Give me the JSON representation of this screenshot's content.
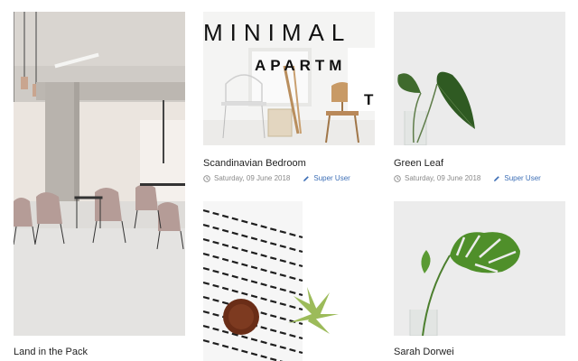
{
  "cards": [
    {
      "title": "Land in the Pack",
      "image_icon": "office-interior-photo"
    },
    {
      "title": "Scandinavian Bedroom",
      "date": "Saturday, 09 June 2018",
      "author": "Super User",
      "image_icon": "scandinavian-room-photo",
      "overlay_line1": "MINIMAL",
      "overlay_line2": "APARTM",
      "overlay_line3": "T"
    },
    {
      "title": "Green Leaf",
      "date": "Saturday, 09 June 2018",
      "author": "Super User",
      "image_icon": "green-leaf-photo"
    },
    {
      "title": "",
      "image_icon": "textile-bowl-photo"
    },
    {
      "title": "Sarah Dorwei",
      "image_icon": "monstera-leaf-photo"
    }
  ],
  "colors": {
    "author_link": "#3d6fb6",
    "meta_text": "#8a8a8a"
  }
}
